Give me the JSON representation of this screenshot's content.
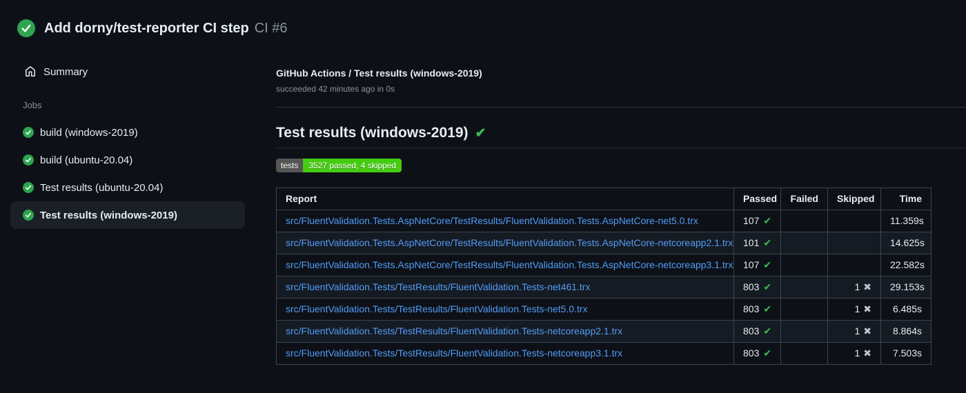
{
  "header": {
    "title": "Add dorny/test-reporter CI step",
    "run_label": "CI #6"
  },
  "sidebar": {
    "summary_label": "Summary",
    "jobs_label": "Jobs",
    "jobs": [
      {
        "label": "build (windows-2019)",
        "status": "success",
        "selected": false
      },
      {
        "label": "build (ubuntu-20.04)",
        "status": "success",
        "selected": false
      },
      {
        "label": "Test results (ubuntu-20.04)",
        "status": "success",
        "selected": false
      },
      {
        "label": "Test results (windows-2019)",
        "status": "success",
        "selected": true
      }
    ]
  },
  "main": {
    "context_title": "GitHub Actions / Test results (windows-2019)",
    "context_subtitle": "succeeded 42 minutes ago in 0s",
    "report_heading": "Test results (windows-2019)",
    "badge": {
      "label": "tests",
      "value": "3527 passed, 4 skipped",
      "label_bg": "#555555",
      "value_bg": "#44cc11"
    },
    "table": {
      "columns": [
        "Report",
        "Passed",
        "Failed",
        "Skipped",
        "Time"
      ],
      "rows": [
        {
          "report": "src/FluentValidation.Tests.AspNetCore/TestResults/FluentValidation.Tests.AspNetCore-net5.0.trx",
          "passed": "107",
          "failed": "",
          "skipped": "",
          "time": "11.359s"
        },
        {
          "report": "src/FluentValidation.Tests.AspNetCore/TestResults/FluentValidation.Tests.AspNetCore-netcoreapp2.1.trx",
          "passed": "101",
          "failed": "",
          "skipped": "",
          "time": "14.625s"
        },
        {
          "report": "src/FluentValidation.Tests.AspNetCore/TestResults/FluentValidation.Tests.AspNetCore-netcoreapp3.1.trx",
          "passed": "107",
          "failed": "",
          "skipped": "",
          "time": "22.582s"
        },
        {
          "report": "src/FluentValidation.Tests/TestResults/FluentValidation.Tests-net461.trx",
          "passed": "803",
          "failed": "",
          "skipped": "1",
          "time": "29.153s"
        },
        {
          "report": "src/FluentValidation.Tests/TestResults/FluentValidation.Tests-net5.0.trx",
          "passed": "803",
          "failed": "",
          "skipped": "1",
          "time": "6.485s"
        },
        {
          "report": "src/FluentValidation.Tests/TestResults/FluentValidation.Tests-netcoreapp2.1.trx",
          "passed": "803",
          "failed": "",
          "skipped": "1",
          "time": "8.864s"
        },
        {
          "report": "src/FluentValidation.Tests/TestResults/FluentValidation.Tests-netcoreapp3.1.trx",
          "passed": "803",
          "failed": "",
          "skipped": "1",
          "time": "7.503s"
        }
      ]
    }
  },
  "icons": {
    "check": "✔",
    "cross": "✖"
  },
  "colors": {
    "background": "#0d1117",
    "status_green": "#2ea44f",
    "cell_check_green": "#3fb950",
    "link_blue": "#539bf5",
    "muted_text": "#8b949e"
  }
}
